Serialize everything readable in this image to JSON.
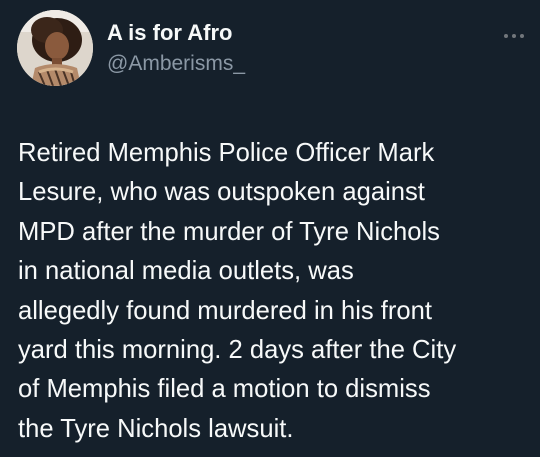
{
  "author": {
    "display_name": "A is for Afro",
    "handle": "@Amberisms_",
    "avatar_icon": "profile-photo"
  },
  "actions": {
    "more_icon": "more-options-icon"
  },
  "tweet": {
    "text_lines": [
      "Retired Memphis Police Officer Mark",
      "Lesure, who was outspoken against",
      "MPD after the murder of Tyre Nichols",
      "in national media outlets, was",
      "allegedly found murdered in his front",
      "yard this morning. 2 days after the City",
      "of Memphis filed a motion to dismiss",
      "the Tyre Nichols lawsuit."
    ]
  },
  "colors": {
    "background": "#15202b",
    "primary_text": "#f7f9f9",
    "secondary_text": "#8b98a5"
  }
}
